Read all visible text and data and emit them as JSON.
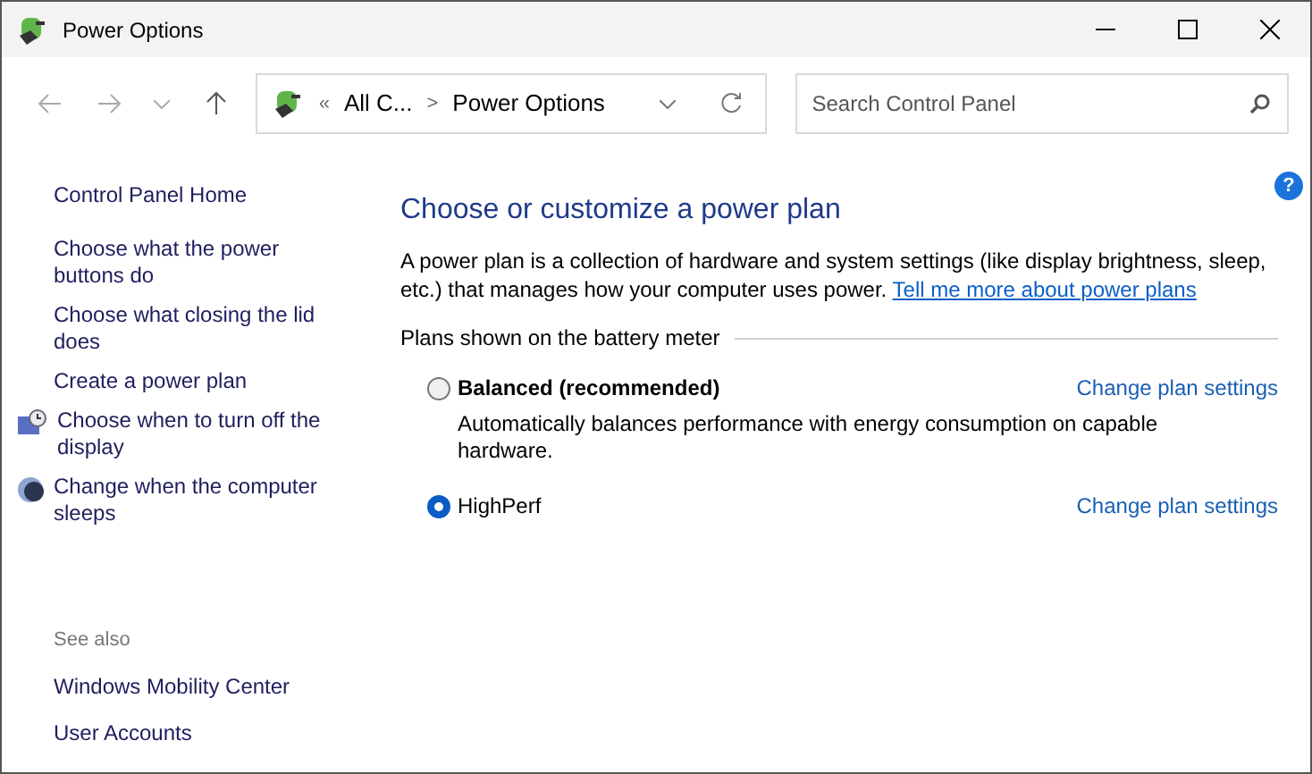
{
  "window": {
    "title": "Power Options"
  },
  "address": {
    "overflow": "«",
    "crumbs": [
      "All C...",
      "Power Options"
    ],
    "separator": ">"
  },
  "search": {
    "placeholder": "Search Control Panel"
  },
  "sidebar": {
    "home": "Control Panel Home",
    "items": [
      {
        "label": "Choose what the power buttons do",
        "kind": "plain"
      },
      {
        "label": "Choose what closing the lid does",
        "kind": "plain"
      },
      {
        "label": "Create a power plan",
        "kind": "plain"
      },
      {
        "label": "Choose when to turn off the display",
        "kind": "display"
      },
      {
        "label": "Change when the computer sleeps",
        "kind": "sleep"
      }
    ],
    "see_also": {
      "heading": "See also",
      "links": [
        "Windows Mobility Center",
        "User Accounts"
      ]
    }
  },
  "help": {
    "label": "?"
  },
  "main": {
    "title": "Choose or customize a power plan",
    "intro": "A power plan is a collection of hardware and system settings (like display brightness, sleep, etc.) that manages how your computer uses power.",
    "intro_link": "Tell me more about power plans",
    "group_label": "Plans shown on the battery meter",
    "plans": [
      {
        "name": "Balanced (recommended)",
        "bold": true,
        "selected": false,
        "action": "Change plan settings",
        "description": "Automatically balances performance with energy consumption on capable hardware."
      },
      {
        "name": "HighPerf",
        "bold": false,
        "selected": true,
        "action": "Change plan settings"
      }
    ]
  }
}
